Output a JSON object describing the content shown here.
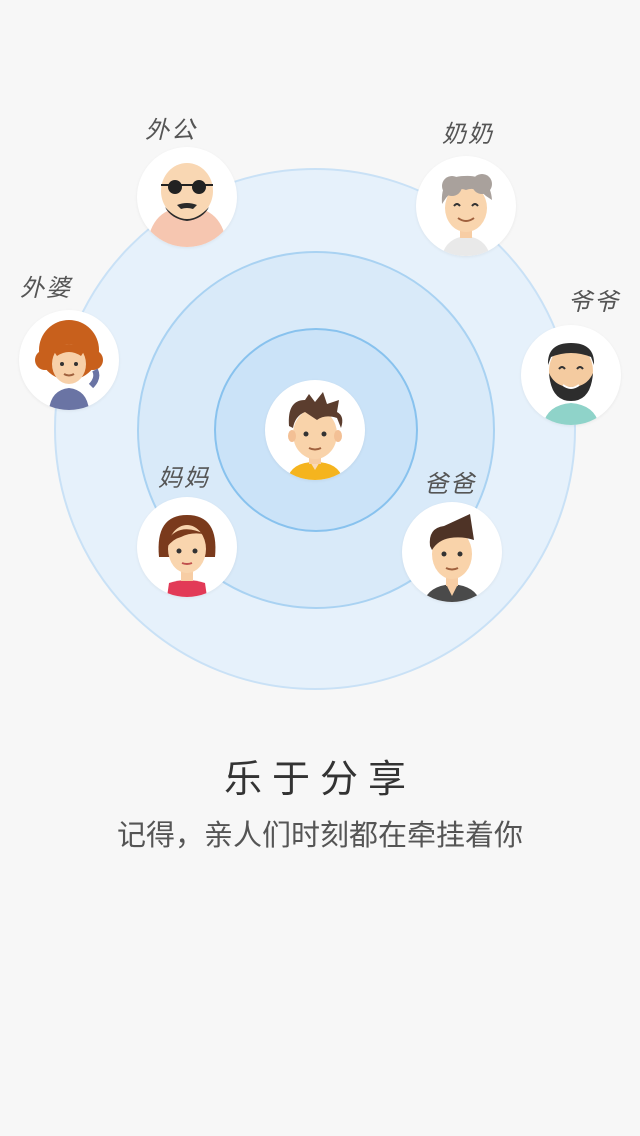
{
  "center_member": {
    "icon": "boy-avatar-icon"
  },
  "members": [
    {
      "id": "grandfather-maternal",
      "label": "外公",
      "icon": "bald-grandpa-avatar-icon"
    },
    {
      "id": "grandmother-paternal",
      "label": "奶奶",
      "icon": "grandma-avatar-icon"
    },
    {
      "id": "grandfather-paternal",
      "label": "爷爷",
      "icon": "bearded-grandpa-avatar-icon"
    },
    {
      "id": "grandmother-maternal",
      "label": "外婆",
      "icon": "curly-grandma-avatar-icon"
    },
    {
      "id": "mother",
      "label": "妈妈",
      "icon": "mom-avatar-icon"
    },
    {
      "id": "father",
      "label": "爸爸",
      "icon": "dad-avatar-icon"
    }
  ],
  "headline": "乐于分享",
  "tagline": "记得，亲人们时刻都在牵挂着你",
  "colors": {
    "background": "#f7f7f7",
    "ring_outer": "#e6f1fb",
    "ring_mid": "#d9eaf9",
    "ring_inner": "#cbe3f8"
  }
}
